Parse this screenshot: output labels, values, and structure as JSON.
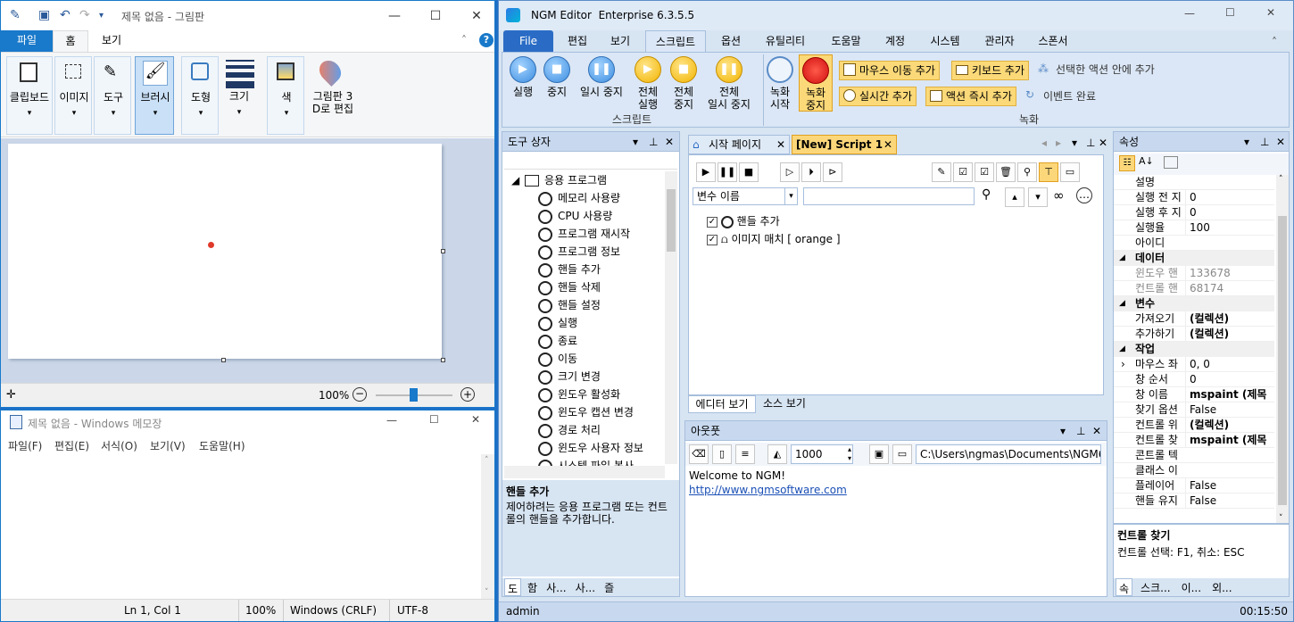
{
  "paint": {
    "title": "제목 없음 - 그림판",
    "tabs": [
      "파일",
      "홈",
      "보기"
    ],
    "groups": [
      {
        "label": "클립보드"
      },
      {
        "label": "이미지"
      },
      {
        "label": "도구"
      },
      {
        "label": "브러시"
      },
      {
        "label": "도형"
      },
      {
        "label": "크기"
      },
      {
        "label": "색"
      },
      {
        "label": "그림판 3",
        "label2": "D로 편집"
      }
    ],
    "zoom": "100%"
  },
  "notepad": {
    "title": "제목 없음 - Windows 메모장",
    "menus": [
      "파일(F)",
      "편집(E)",
      "서식(O)",
      "보기(V)",
      "도움말(H)"
    ],
    "status": {
      "pos": "Ln 1, Col 1",
      "zoom": "100%",
      "eol": "Windows (CRLF)",
      "enc": "UTF-8"
    }
  },
  "ngm": {
    "title": "NGM Editor  Enterprise 6.3.5.5",
    "tabs": [
      "File",
      "편집",
      "보기",
      "스크립트",
      "옵션",
      "유틸리티",
      "도움말",
      "계정",
      "시스템",
      "관리자",
      "스폰서"
    ],
    "ribbon": {
      "play": "실행",
      "stop": "중지",
      "pause": "일시 중지",
      "all_play": [
        "전체",
        "실행"
      ],
      "all_stop": [
        "전체",
        "중지"
      ],
      "all_pause": [
        "전체",
        "일시 중지"
      ],
      "group_script": "스크립트",
      "rec_start": [
        "녹화",
        "시작"
      ],
      "rec_stop": [
        "녹화",
        "중지"
      ],
      "mouse": "마우스 이동 추가",
      "key": "키보드 추가",
      "in_action": "선택한 액션 안에 추가",
      "realtime": "실시간 추가",
      "action_now": "액션 즉시 추가",
      "event_done": "이벤트 완료",
      "group_rec": "녹화"
    },
    "toolbox": {
      "title": "도구 상자",
      "root": "응용 프로그램",
      "items": [
        "메모리 사용량",
        "CPU 사용량",
        "프로그램 재시작",
        "프로그램 정보",
        "핸들 추가",
        "핸들 삭제",
        "핸들 설정",
        "실행",
        "종료",
        "이동",
        "크기 변경",
        "윈도우 활성화",
        "윈도우 캡션 변경",
        "경로 처리",
        "윈도우 사용자 정보",
        "시스템 파일 복사"
      ],
      "desc_title": "핸들 추가",
      "desc": "제어하려는 응용 프로그램 또는 컨트롤의 핸들을 추가합니다.",
      "bottom_tabs": [
        "도",
        "함",
        "사...",
        "사...",
        "즐"
      ]
    },
    "editor": {
      "tabs": [
        "시작 페이지",
        "[New] Script 1"
      ],
      "var_select": "변수 이름",
      "items": [
        {
          "label": "핸들 추가"
        },
        {
          "label": "이미지 매치 [ orange ]"
        }
      ],
      "view_tabs": [
        "에디터 보기",
        "소스 보기"
      ]
    },
    "output": {
      "title": "아웃풋",
      "count": "1000",
      "path": "C:\\Users\\ngmas\\Documents\\NGM6\\",
      "line1": "Welcome to NGM!",
      "link": "http://www.ngmsoftware.com"
    },
    "props": {
      "title": "속성",
      "rows": [
        {
          "k": "설명",
          "v": ""
        },
        {
          "k": "실행 전 지",
          "v": "0"
        },
        {
          "k": "실행 후 지",
          "v": "0"
        },
        {
          "k": "실행율",
          "v": "100"
        },
        {
          "k": "아이디",
          "v": ""
        },
        {
          "cat": "데이터"
        },
        {
          "k": "윈도우 핸",
          "v": "133678",
          "grey": true
        },
        {
          "k": "컨트롤 핸",
          "v": "68174",
          "grey": true
        },
        {
          "cat": "변수"
        },
        {
          "k": "가져오기",
          "v": "(컬렉션)",
          "bold": true
        },
        {
          "k": "추가하기",
          "v": "(컬렉션)",
          "bold": true
        },
        {
          "cat": "작업"
        },
        {
          "k": "마우스 좌",
          "v": "0, 0",
          "exp": true
        },
        {
          "k": "창 순서",
          "v": "0"
        },
        {
          "k": "창 이름",
          "v": "mspaint (제목",
          "bold": true
        },
        {
          "k": "찾기 옵션",
          "v": "False"
        },
        {
          "k": "컨트롤 위",
          "v": "(컬렉션)",
          "bold": true
        },
        {
          "k": "컨트롤 찾",
          "v": "mspaint (제목",
          "bold": true
        },
        {
          "k": "콘트롤 텍",
          "v": ""
        },
        {
          "k": "클래스 이",
          "v": ""
        },
        {
          "k": "플레이어",
          "v": "False"
        },
        {
          "k": "핸들 유지",
          "v": "False"
        }
      ],
      "desc_title": "컨트롤 찾기",
      "desc": "컨트롤 선택: F1, 취소: ESC",
      "bottom_tabs": [
        "속",
        "스크...",
        "이...",
        "외..."
      ]
    },
    "status": {
      "user": "admin",
      "time": "00:15:50"
    }
  }
}
